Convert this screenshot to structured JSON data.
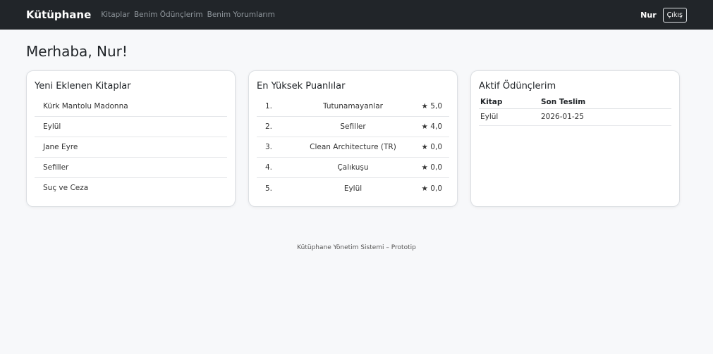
{
  "navbar": {
    "brand": "Kütüphane",
    "links": [
      "Kitaplar",
      "Benim Ödünçlerim",
      "Benim Yorumlarım"
    ],
    "user": "Nur",
    "logout_label": "Çıkış"
  },
  "page": {
    "greeting": "Merhaba, Nur!"
  },
  "new_books": {
    "title": "Yeni Eklenen Kitaplar",
    "items": [
      "Kürk Mantolu Madonna",
      "Eylül",
      "Jane Eyre",
      "Sefiller",
      "Suç ve Ceza"
    ]
  },
  "top_rated": {
    "title": "En Yüksek Puanlılar",
    "items": [
      {
        "rank": "1.",
        "title": "Tutunamayanlar",
        "rating": "★ 5,0"
      },
      {
        "rank": "2.",
        "title": "Sefiller",
        "rating": "★ 4,0"
      },
      {
        "rank": "3.",
        "title": "Clean Architecture (TR)",
        "rating": "★ 0,0"
      },
      {
        "rank": "4.",
        "title": "Çalıkuşu",
        "rating": "★ 0,0"
      },
      {
        "rank": "5.",
        "title": "Eylül",
        "rating": "★ 0,0"
      }
    ]
  },
  "active_loans": {
    "title": "Aktif Ödünçlerim",
    "headers": [
      "Kitap",
      "Son Teslim"
    ],
    "rows": [
      {
        "book": "Eylül",
        "due": "2026-01-25"
      }
    ]
  },
  "footer": {
    "text": "Kütüphane Yönetim Sistemi – Prototip"
  },
  "colors": {
    "navbar_bg": "#212529",
    "page_bg": "#f7f8fa",
    "card_bg": "#ffffff"
  }
}
